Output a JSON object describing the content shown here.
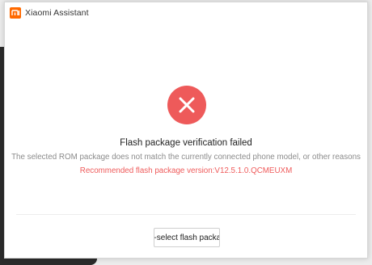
{
  "window": {
    "title": "Xiaomi Assistant",
    "logo_icon": "mi-logo-icon",
    "logo_color": "#ff6900"
  },
  "status": {
    "icon": "error-x-icon",
    "color": "#ee5a5a"
  },
  "message": {
    "headline": "Flash package verification failed",
    "detail": "The selected ROM package does not match the currently connected phone model, or other reasons",
    "recommended_label": "Recommended flash package version:",
    "recommended_version": "V12.5.1.0.QCMEUXM",
    "recommended_color": "#ef5b5b"
  },
  "actions": {
    "reselect_label": "Re-select flash package"
  }
}
